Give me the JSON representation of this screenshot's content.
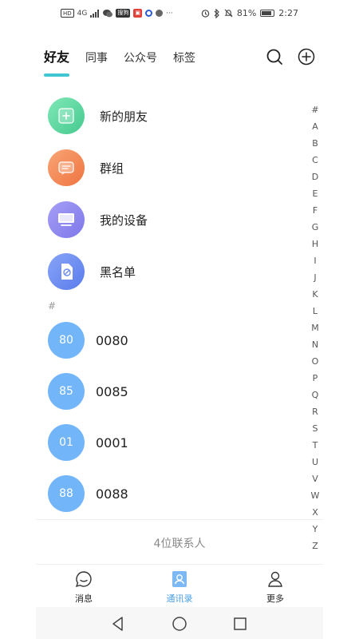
{
  "status_bar": {
    "left_hd": "HD",
    "left_network": "4G",
    "left_sohu": "搜狗",
    "left_more": "···",
    "battery": "81%",
    "time": "2:27"
  },
  "tabs": [
    "好友",
    "同事",
    "公众号",
    "标签"
  ],
  "features": [
    "新的朋友",
    "群组",
    "我的设备",
    "黑名单"
  ],
  "section_header": "#",
  "contacts": [
    {
      "avatar": "80",
      "name": "0080"
    },
    {
      "avatar": "85",
      "name": "0085"
    },
    {
      "avatar": "01",
      "name": "0001"
    },
    {
      "avatar": "88",
      "name": "0088"
    }
  ],
  "contact_count": "4位联系人",
  "alpha_index": [
    "#",
    "A",
    "B",
    "C",
    "D",
    "E",
    "F",
    "G",
    "H",
    "I",
    "J",
    "K",
    "L",
    "M",
    "N",
    "O",
    "P",
    "Q",
    "R",
    "S",
    "T",
    "U",
    "V",
    "W",
    "X",
    "Y",
    "Z"
  ],
  "bottom_nav": [
    "消息",
    "通讯录",
    "更多"
  ],
  "colors": {
    "accent": "#3fc6d1",
    "avatar_blue": "#72b5f8",
    "nav_active": "#4a9ee8",
    "new_friend": "#5fd8a0",
    "group": "#f58c58",
    "device": "#8c86f0",
    "blacklist": "#6a8cf2"
  }
}
